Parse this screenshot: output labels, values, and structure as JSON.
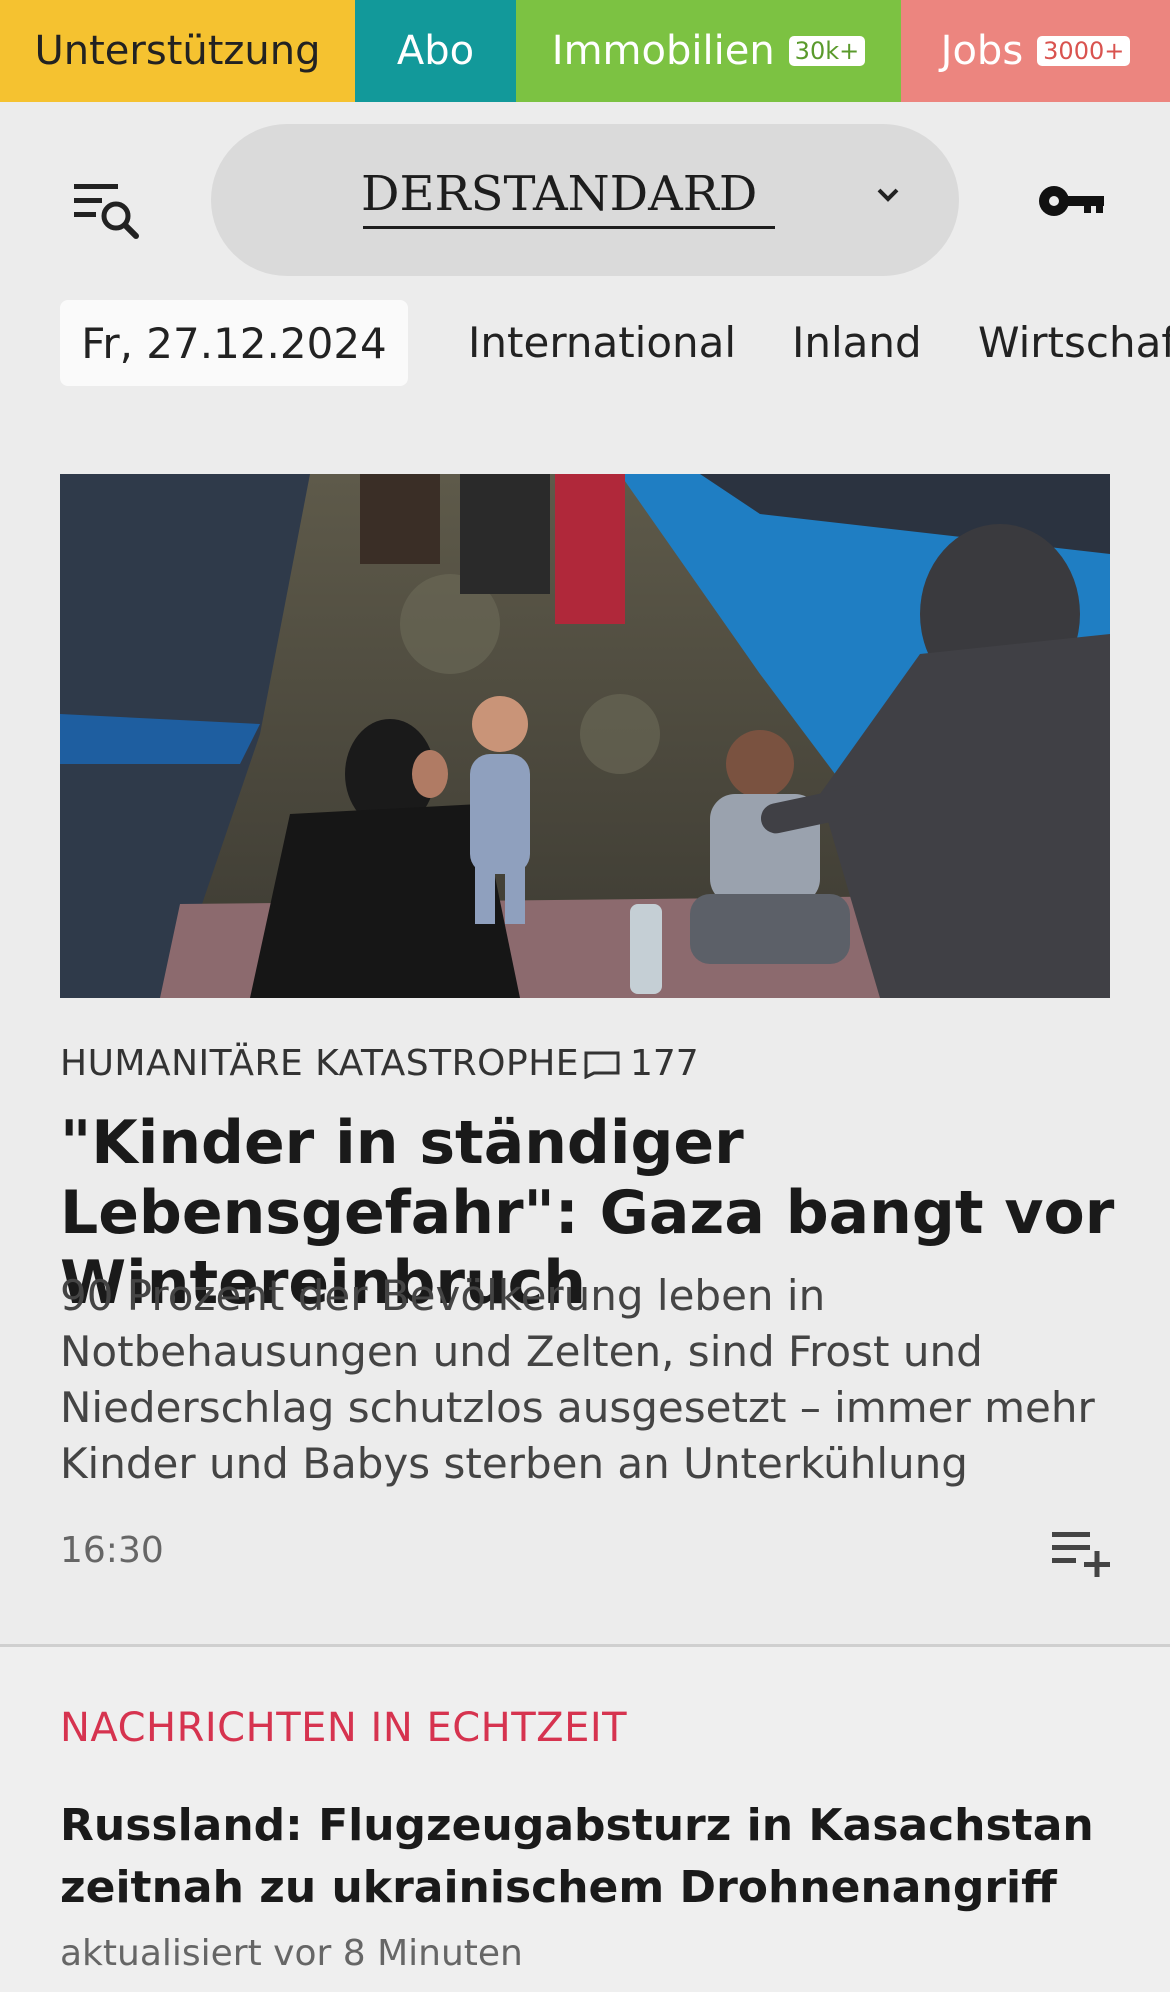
{
  "topbar": {
    "support_label": "Unterstützung",
    "abo_label": "Abo",
    "immo_label": "Immobilien",
    "immo_badge": "30k+",
    "jobs_label": "Jobs",
    "jobs_badge": "3000+",
    "colors": {
      "support": "#f5c230",
      "abo": "#12999a",
      "immo": "#7cc242",
      "jobs": "#ec857f"
    }
  },
  "header": {
    "logo": "DERSTANDARD",
    "menu_icon": "menu-search-icon",
    "login_icon": "key-icon"
  },
  "nav": {
    "date": "Fr, 27.12.2024",
    "items": [
      "International",
      "Inland",
      "Wirtschaft"
    ]
  },
  "hero": {
    "kicker": "HUMANITÄRE KATASTROPHE",
    "comments": "177",
    "headline": "\"Kinder in ständiger Lebensgefahr\": Gaza bangt vor Wintereinbruch",
    "teaser": "90 Prozent der Bevölkerung leben in Notbehausungen und Zelten, sind Frost und Niederschlag schutzlos ausgesetzt – immer mehr Kinder und Babys sterben an Unterkühlung",
    "time": "16:30"
  },
  "live": {
    "label": "NACHRICHTEN IN ECHTZEIT",
    "headline": "Russland: Flugzeugabsturz in Kasachstan zeitnah zu ukrainischem Drohnenangriff",
    "updated": "aktualisiert vor 8 Minuten",
    "accent": "#d6334f"
  }
}
